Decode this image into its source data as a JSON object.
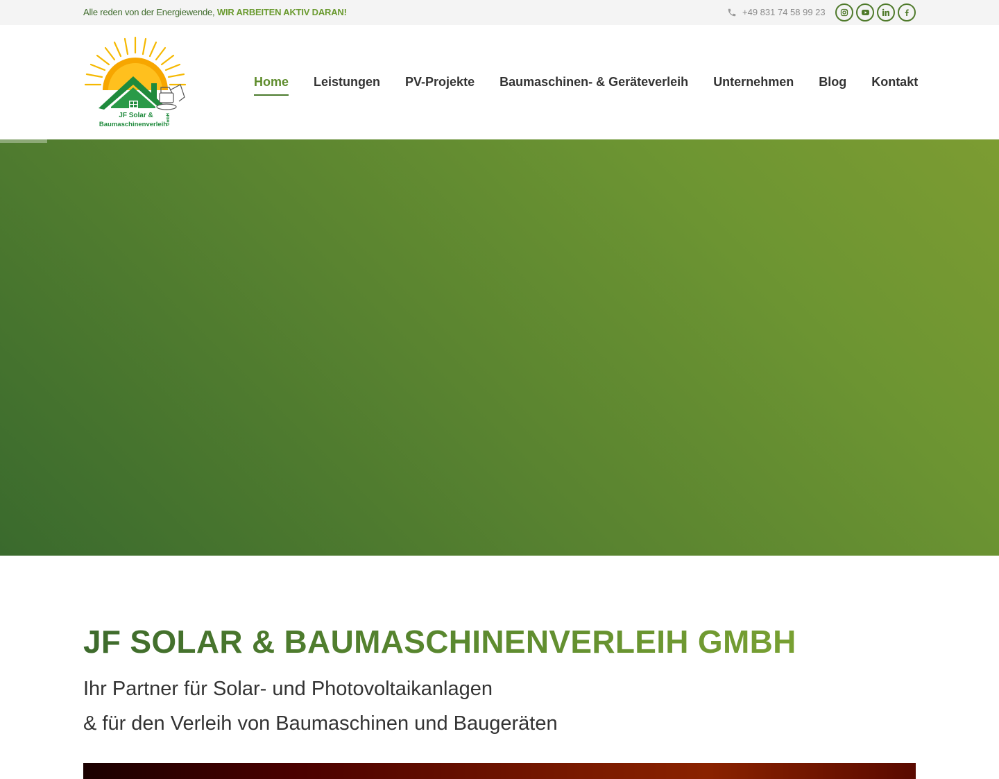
{
  "topbar": {
    "tagline_prefix": "Alle reden von der Energiewende, ",
    "tagline_highlight": "WIR ARBEITEN AKTIV DARAN!",
    "phone": "+49 831 74 58 99 23",
    "socials": [
      {
        "name": "instagram-icon"
      },
      {
        "name": "youtube-icon"
      },
      {
        "name": "linkedin-icon"
      },
      {
        "name": "facebook-icon"
      }
    ]
  },
  "logo": {
    "line1": "JF Solar &",
    "line2": "Baumaschinenverleih",
    "suffix": "GmbH"
  },
  "nav": {
    "items": [
      {
        "label": "Home",
        "active": true
      },
      {
        "label": "Leistungen"
      },
      {
        "label": "PV-Projekte"
      },
      {
        "label": "Baumaschinen- & Geräteverleih"
      },
      {
        "label": "Unternehmen"
      },
      {
        "label": "Blog"
      },
      {
        "label": "Kontakt"
      }
    ]
  },
  "intro": {
    "title": "JF SOLAR & BAUMASCHINENVERLEIH GMBH",
    "line1": "Ihr Partner für Solar- und Photovoltaikanlagen",
    "line2": "& für den Verleih von Baumaschinen und Baugeräten"
  },
  "colors": {
    "accent": "#5e8c2c",
    "dark_green": "#3d6a2c",
    "topbar_bg": "#f4f4f4"
  }
}
